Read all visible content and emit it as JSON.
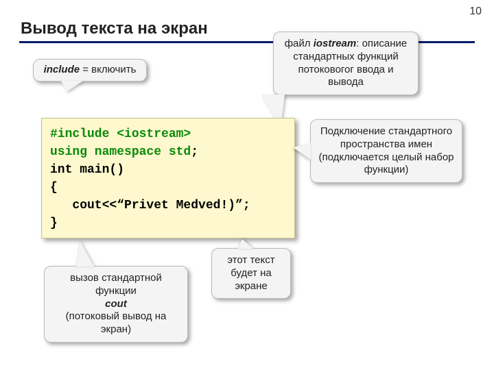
{
  "page_number": "10",
  "title": "Вывод текста на экран",
  "code": {
    "line1a": "#include ",
    "line1b": "<iostream>",
    "line2a": "using namespace std",
    "line2b": ";",
    "line3": "int main()",
    "line4": "{",
    "line5": "   cout<<“Privet Medved!)”;",
    "line6": "}"
  },
  "callouts": {
    "include_label": "include",
    "include_rest": " = включить",
    "iostream_prefix": "файл ",
    "iostream_word": "iostream",
    "iostream_rest": ": описание стандартных функций потоковогог ввода и вывода",
    "namespace_text": "Подключение стандартного пространства имен (подключается целый набор функции)",
    "screentext_text": "этот текст будет на экране",
    "cout_prefix": "вызов стандартной функции",
    "cout_word": "cout",
    "cout_rest": "(потоковый вывод на экран)"
  }
}
